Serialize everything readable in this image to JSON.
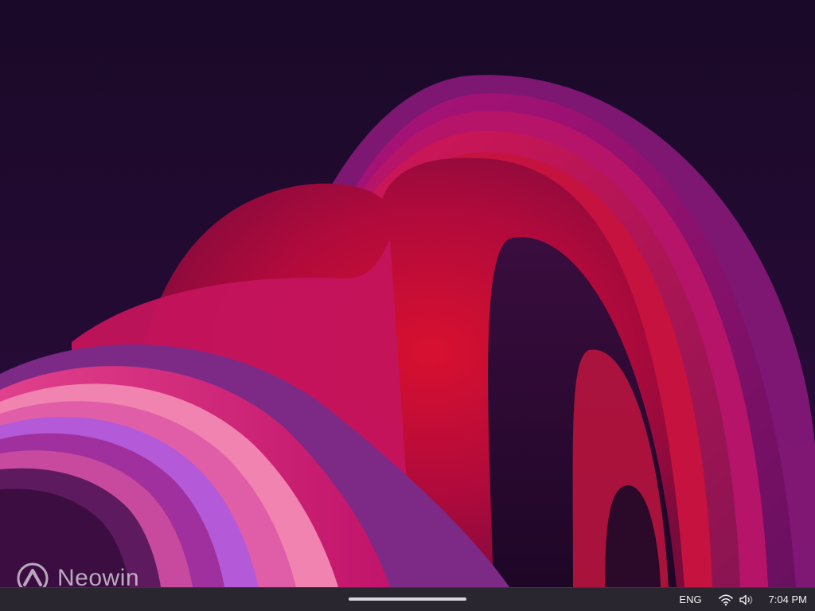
{
  "wallpaper": {
    "name": "abstract-bloom-wallpaper",
    "colors": {
      "background_top": "#1d0a2e",
      "background_bottom": "#2b0d3e",
      "red": "#d0103a",
      "magenta": "#c1146a",
      "pink": "#f06aa8",
      "purple": "#8b2a8f",
      "violet": "#b55be0",
      "deep": "#3a0a30"
    }
  },
  "watermark": {
    "icon": "neowin-logo-icon",
    "text": "Neowin"
  },
  "taskbar": {
    "background": "#2a2630",
    "home_indicator": "home-indicator",
    "tray": {
      "language": "ENG",
      "wifi_icon": "wifi-icon",
      "volume_icon": "volume-icon",
      "time": "7:04 PM"
    }
  }
}
